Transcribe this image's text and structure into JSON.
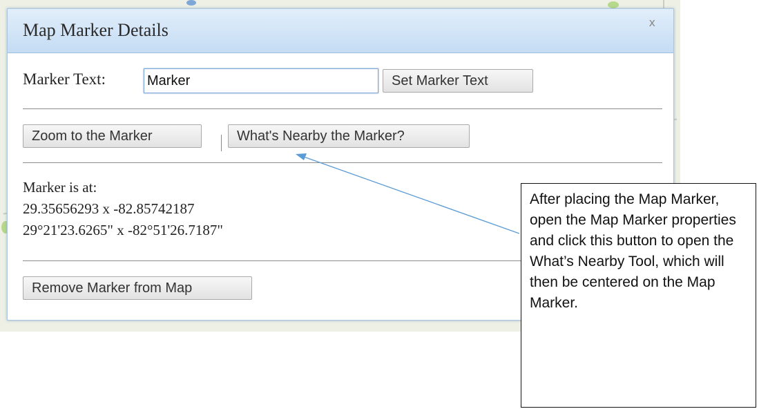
{
  "dialog": {
    "title": "Map Marker Details",
    "close_glyph": "x",
    "marker_text_label": "Marker Text:",
    "marker_text_value": "Marker",
    "set_marker_text_button": "Set Marker Text",
    "zoom_button": "Zoom to the Marker",
    "separator": "|",
    "whats_nearby_button": "What's Nearby the Marker?",
    "location_heading": "Marker is at:",
    "decimal_coords": "29.35656293 x -82.85742187",
    "dms_coords": "29°21'23.6265\" x -82°51'26.7187\"",
    "remove_button": "Remove Marker from Map"
  },
  "callout": {
    "text": "After placing the Map Marker, open the Map Marker properties and click this button to open the What’s Nearby Tool, which will then be centered on the Map Marker."
  },
  "colors": {
    "header_gradient_top": "#e2eefa",
    "header_gradient_bottom": "#c4dcf4",
    "arrow": "#5b9bd5"
  },
  "icons": {
    "close": "close-icon"
  }
}
